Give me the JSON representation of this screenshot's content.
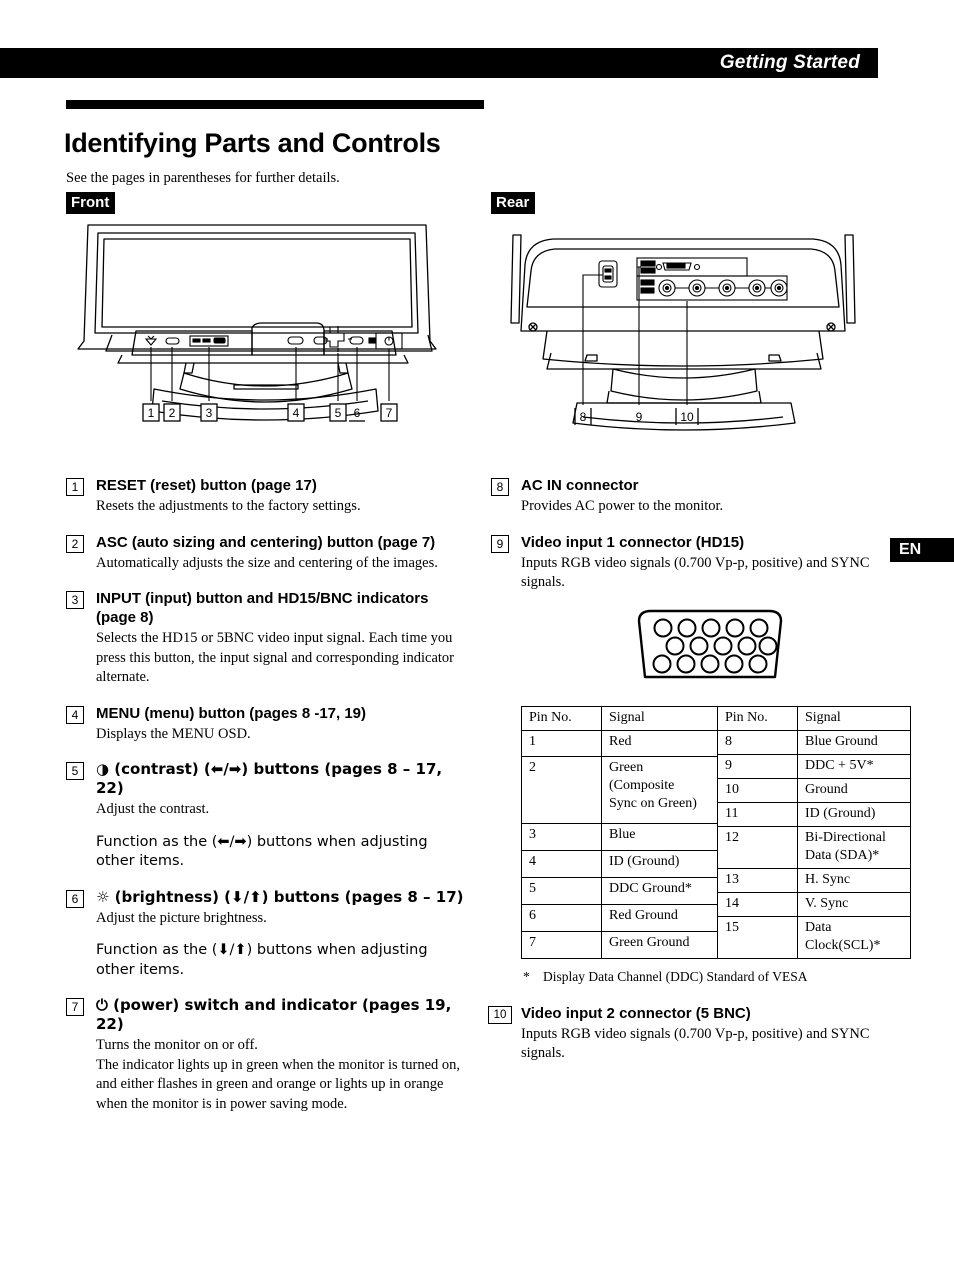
{
  "header": {
    "running_title": "Getting Started",
    "language_tab": "EN"
  },
  "page": {
    "title": "Identifying Parts and Controls",
    "intro": "See the pages in parentheses for further details."
  },
  "sections": {
    "front_label": "Front",
    "rear_label": "Rear"
  },
  "front_callouts": [
    "1",
    "2",
    "3",
    "4",
    "5",
    "6",
    "7"
  ],
  "rear_callouts": [
    "8",
    "9",
    "10"
  ],
  "front_items": [
    {
      "num": "1",
      "head": "RESET (reset) button (page 17)",
      "body": [
        "Resets the adjustments to the factory settings."
      ]
    },
    {
      "num": "2",
      "head": "ASC (auto sizing and centering) button (page 7)",
      "body": [
        "Automatically adjusts the size and centering of the images."
      ]
    },
    {
      "num": "3",
      "head": "INPUT (input) button and HD15/BNC indicators (page 8)",
      "body": [
        "Selects the HD15 or 5BNC video input signal. Each time you press this button, the input signal and corresponding indicator alternate."
      ]
    },
    {
      "num": "4",
      "head": "MENU (menu) button (pages 8 -17, 19)",
      "body": [
        "Displays the MENU OSD."
      ]
    },
    {
      "num": "5",
      "head": "◑ (contrast) (⬅/➡) buttons (pages 8 – 17, 22)",
      "body": [
        "Adjust the contrast.",
        "Function as the (⬅/➡) buttons when adjusting other items."
      ]
    },
    {
      "num": "6",
      "head": "☼ (brightness) (⬇/⬆) buttons (pages  8 – 17)",
      "body": [
        "Adjust the picture brightness.",
        "Function as the (⬇/⬆) buttons when adjusting other items."
      ]
    },
    {
      "num": "7",
      "head": "⏻ (power) switch and indicator (pages 19, 22)",
      "body": [
        "Turns the monitor on or off.\nThe indicator lights up in green when the monitor is turned on, and either flashes in green and orange or lights up in orange when the monitor is in power saving mode."
      ]
    }
  ],
  "rear_items": [
    {
      "num": "8",
      "head": "AC IN connector",
      "body": [
        "Provides AC power to the monitor."
      ]
    },
    {
      "num": "9",
      "head": "Video input 1 connector (HD15)",
      "body": [
        "Inputs RGB video signals (0.700 Vp-p, positive) and SYNC signals."
      ]
    },
    {
      "num": "10",
      "head": "Video input 2 connector (5 BNC)",
      "body": [
        "Inputs RGB video signals (0.700 Vp-p, positive) and SYNC signals."
      ]
    }
  ],
  "pin_table": {
    "headers": [
      "Pin No.",
      "Signal",
      "Pin No.",
      "Signal"
    ],
    "left_rows": [
      {
        "pin": "1",
        "signal": "Red"
      },
      {
        "pin": "2",
        "signal": "Green\n(Composite\nSync on Green)"
      },
      {
        "pin": "3",
        "signal": "Blue"
      },
      {
        "pin": "4",
        "signal": "ID (Ground)"
      },
      {
        "pin": "5",
        "signal": "DDC Ground*"
      },
      {
        "pin": "6",
        "signal": "Red Ground"
      },
      {
        "pin": "7",
        "signal": "Green Ground"
      }
    ],
    "right_rows": [
      {
        "pin": "8",
        "signal": "Blue Ground"
      },
      {
        "pin": "9",
        "signal": "DDC + 5V*"
      },
      {
        "pin": "10",
        "signal": "Ground"
      },
      {
        "pin": "11",
        "signal": "ID (Ground)"
      },
      {
        "pin": "12",
        "signal": "Bi-Directional\nData (SDA)*"
      },
      {
        "pin": "13",
        "signal": "H. Sync"
      },
      {
        "pin": "14",
        "signal": "V. Sync"
      },
      {
        "pin": "15",
        "signal": "Data Clock(SCL)*"
      }
    ]
  },
  "footnote": {
    "star": "*",
    "text": "Display Data Channel (DDC) Standard of VESA"
  }
}
